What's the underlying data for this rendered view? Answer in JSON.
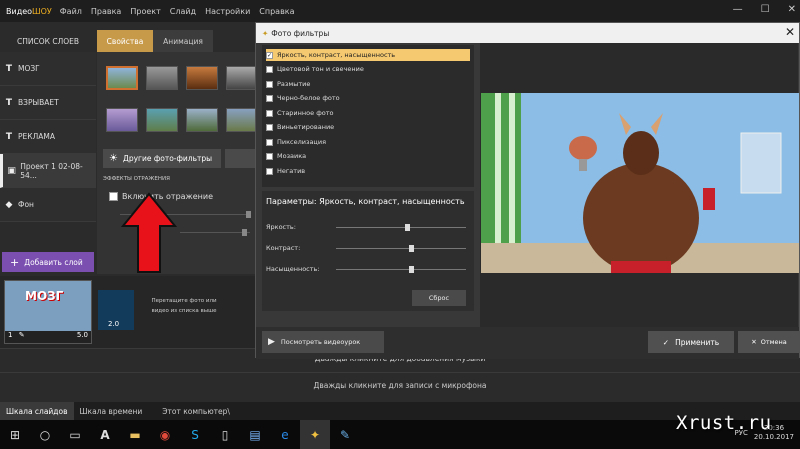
{
  "app": {
    "logo_prefix": "Видео",
    "logo_brand": "ШОУ"
  },
  "menu": [
    "Файл",
    "Правка",
    "Проект",
    "Слайд",
    "Настройки",
    "Справка"
  ],
  "window_controls": [
    "—",
    "☐",
    "✕"
  ],
  "left_panel": {
    "header": "СПИСОК СЛОЕВ",
    "layers": [
      {
        "icon": "T",
        "label": "МОЗГ"
      },
      {
        "icon": "T",
        "label": "ВЗРЫВАЕТ"
      },
      {
        "icon": "T",
        "label": "РЕКЛАМА"
      },
      {
        "icon": "▣",
        "label": "Проект 1 02-08-54..."
      },
      {
        "icon": "◆",
        "label": "Фон"
      }
    ],
    "add_layer": "Добавить слой"
  },
  "tabs": {
    "properties": "Свойства",
    "animation": "Анимация"
  },
  "properties": {
    "more_filters": "Другие фото-фильтры",
    "reflection_header": "ЭФФЕКТЫ ОТРАЖЕНИЯ",
    "reflection_checkbox": "Включить отражение"
  },
  "timeline": {
    "thumb_caption": "МОЗГ",
    "slide_number": "1",
    "slide_duration": "5.0",
    "transition_duration": "2.0",
    "hint": "Перетащите фото или видео из списка выше",
    "music_hint": "Дважды кликните для добавления музыки",
    "mic_hint": "Дважды кликните для записи с микрофона"
  },
  "statusbar": {
    "slides": "Шкала слайдов",
    "timeline": "Шкала времени",
    "path": "Этот компьютер\\"
  },
  "dialog": {
    "title": "Фото фильтры",
    "filters": [
      {
        "label": "Яркость, контраст, насыщенность",
        "checked": true
      },
      {
        "label": "Цветовой тон и свечение",
        "checked": false
      },
      {
        "label": "Размытие",
        "checked": false
      },
      {
        "label": "Черно-белое фото",
        "checked": false
      },
      {
        "label": "Старинное фото",
        "checked": false
      },
      {
        "label": "Виньетирование",
        "checked": false
      },
      {
        "label": "Пикселизация",
        "checked": false
      },
      {
        "label": "Мозаика",
        "checked": false
      },
      {
        "label": "Негатив",
        "checked": false
      }
    ],
    "params_title": "Параметры: Яркость, контраст, насыщенность",
    "params": [
      {
        "label": "Яркость:",
        "value": 0.55
      },
      {
        "label": "Контраст:",
        "value": 0.58
      },
      {
        "label": "Насыщенность:",
        "value": 0.58
      }
    ],
    "reset": "Сброс",
    "watch": "Посмотреть видеоурок",
    "apply": "Применить",
    "cancel": "Отмена"
  },
  "taskbar": {
    "lang": "РУС",
    "time": "20:36",
    "date": "20.10.2017"
  },
  "watermark": "Xrust.ru"
}
